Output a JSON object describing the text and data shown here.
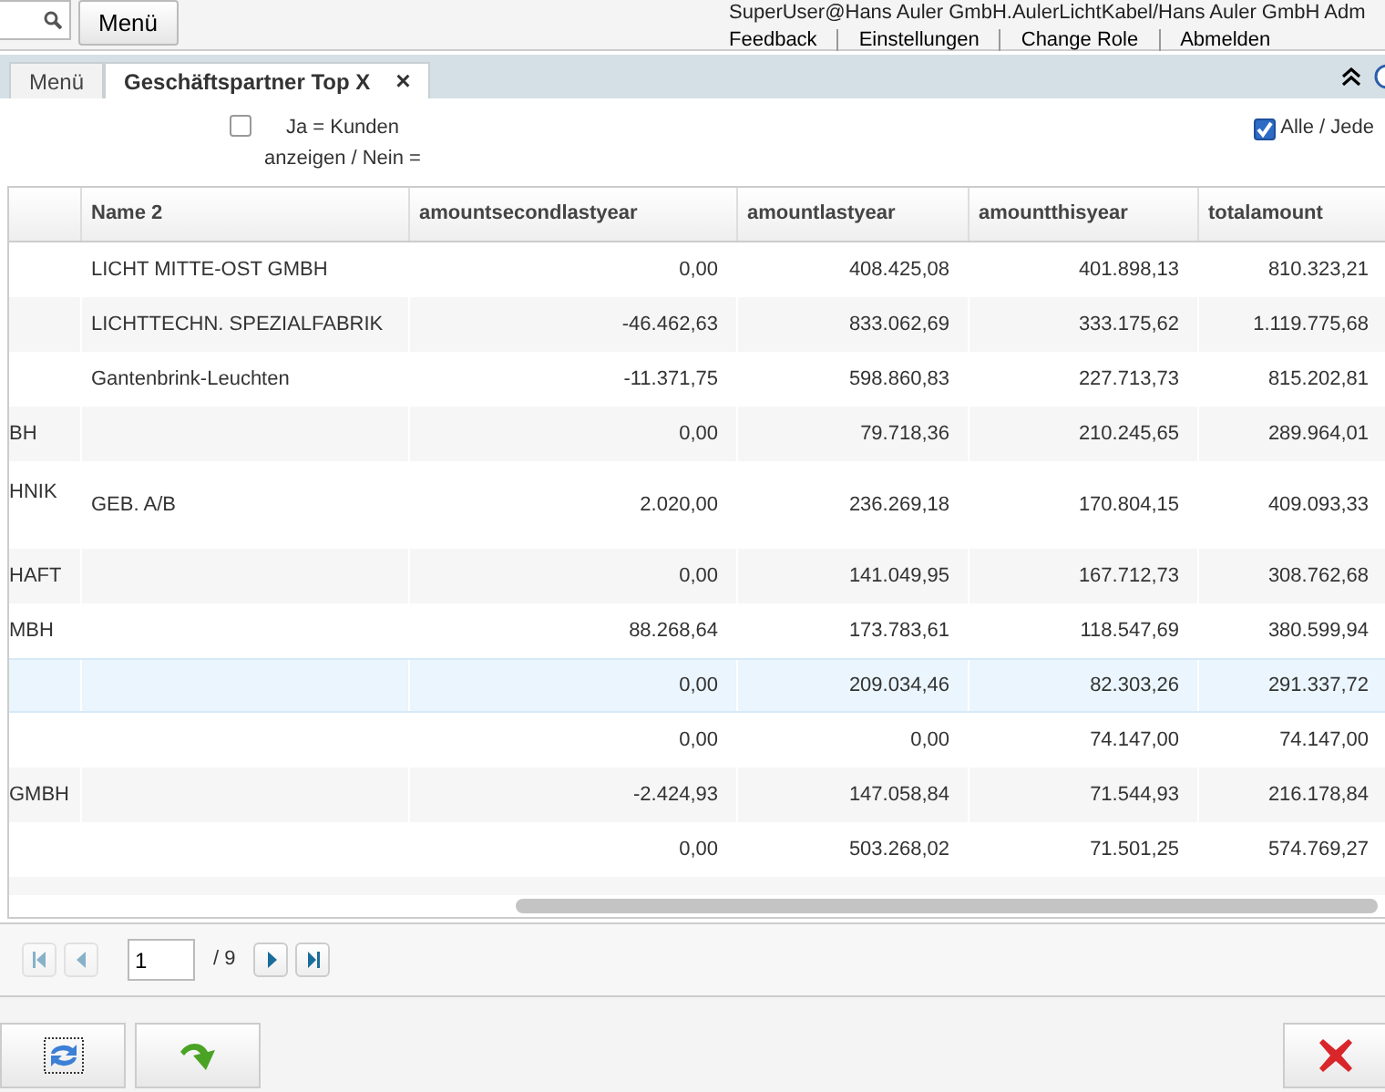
{
  "header": {
    "menu_button": "Menü",
    "user": "SuperUser@Hans Auler GmbH.AulerLichtKabel/Hans Auler GmbH Adm",
    "links": [
      "Feedback",
      "Einstellungen",
      "Change Role",
      "Abmelden"
    ]
  },
  "tabs": [
    {
      "label": "Menü",
      "selected": false,
      "closable": false
    },
    {
      "label": "Geschäftspartner Top X",
      "selected": true,
      "closable": true
    }
  ],
  "close_glyph": "×",
  "filters": [
    {
      "label": "Ja = Kunden anzeigen / Nein =",
      "checked": false
    },
    {
      "label": "Alle / Jede",
      "checked": true
    }
  ],
  "table": {
    "columns": [
      "",
      "Name 2",
      "amountsecondlastyear",
      "amountlastyear",
      "amountthisyear",
      "totalamount"
    ],
    "rows": [
      {
        "selected": false,
        "tall": false,
        "cells": [
          "",
          "LICHT MITTE-OST GMBH",
          "0,00",
          "408.425,08",
          "401.898,13",
          "810.323,21"
        ]
      },
      {
        "selected": false,
        "tall": false,
        "cells": [
          "",
          "LICHTTECHN. SPEZIALFABRIK",
          "-46.462,63",
          "833.062,69",
          "333.175,62",
          "1.119.775,68"
        ]
      },
      {
        "selected": false,
        "tall": false,
        "cells": [
          "",
          "Gantenbrink-Leuchten",
          "-11.371,75",
          "598.860,83",
          "227.713,73",
          "815.202,81"
        ]
      },
      {
        "selected": false,
        "tall": false,
        "cells": [
          "BH",
          "",
          "0,00",
          "79.718,36",
          "210.245,65",
          "289.964,01"
        ]
      },
      {
        "selected": false,
        "tall": true,
        "cells": [
          "HNIK",
          "GEB. A/B",
          "2.020,00",
          "236.269,18",
          "170.804,15",
          "409.093,33"
        ]
      },
      {
        "selected": false,
        "tall": false,
        "cells": [
          "HAFT",
          "",
          "0,00",
          "141.049,95",
          "167.712,73",
          "308.762,68"
        ]
      },
      {
        "selected": false,
        "tall": false,
        "cells": [
          "MBH",
          "",
          "88.268,64",
          "173.783,61",
          "118.547,69",
          "380.599,94"
        ]
      },
      {
        "selected": true,
        "tall": false,
        "cells": [
          "",
          "",
          "0,00",
          "209.034,46",
          "82.303,26",
          "291.337,72"
        ]
      },
      {
        "selected": false,
        "tall": false,
        "cells": [
          "",
          "",
          "0,00",
          "0,00",
          "74.147,00",
          "74.147,00"
        ]
      },
      {
        "selected": false,
        "tall": false,
        "cells": [
          "GMBH",
          "",
          "-2.424,93",
          "147.058,84",
          "71.544,93",
          "216.178,84"
        ]
      },
      {
        "selected": false,
        "tall": false,
        "cells": [
          "",
          "",
          "0,00",
          "503.268,02",
          "71.501,25",
          "574.769,27"
        ]
      }
    ]
  },
  "pager": {
    "page": "1",
    "total": "/ 9"
  }
}
